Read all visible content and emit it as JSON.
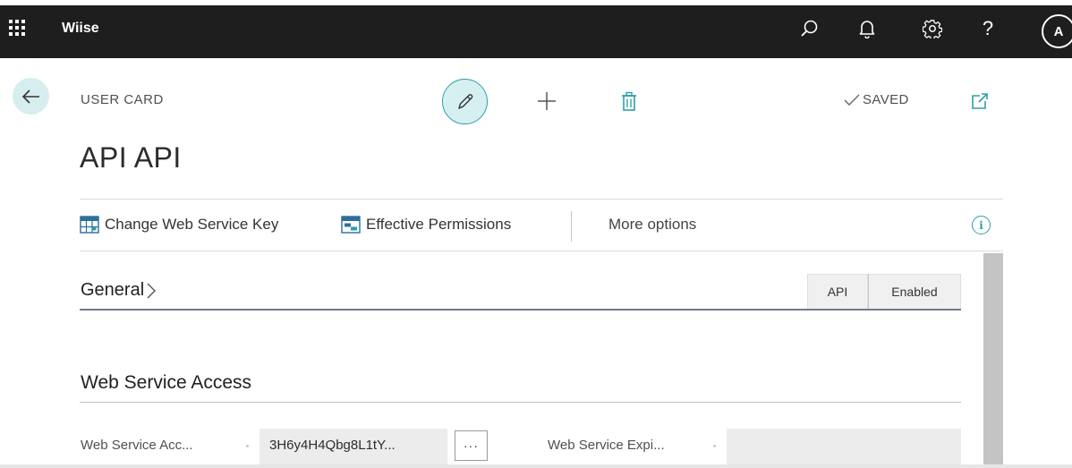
{
  "app": {
    "name": "Wiise",
    "avatar_initial": "A"
  },
  "header_icons": [
    "search-icon",
    "bell-icon",
    "gear-icon",
    "help-icon"
  ],
  "header_help_glyph": "?",
  "card": {
    "kind": "USER CARD",
    "title": "API API",
    "status": "SAVED"
  },
  "actions": {
    "change_key": "Change Web Service Key",
    "effective_permissions": "Effective Permissions",
    "more_options": "More options"
  },
  "sections": {
    "general": {
      "title": "General",
      "summary": [
        "API",
        "Enabled"
      ]
    },
    "web_service_access": {
      "title": "Web Service Access",
      "fields": {
        "key_label": "Web Service Acc...",
        "key_value": "3H6y4H4Qbg8L1tY...",
        "assist_label": "···",
        "expiry_label": "Web Service Expi...",
        "expiry_value": ""
      }
    }
  },
  "colors": {
    "accent": "#2c9fa8",
    "appbar": "#1e1e1e",
    "accent_soft": "#d6f0f2"
  }
}
